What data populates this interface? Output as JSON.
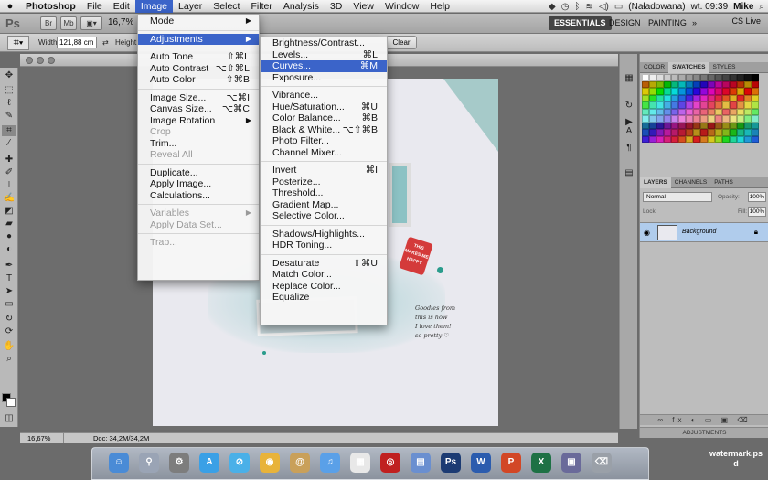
{
  "menubar": {
    "apple": "",
    "app_name": "Photoshop",
    "items": [
      "File",
      "Edit",
      "Image",
      "Layer",
      "Select",
      "Filter",
      "Analysis",
      "3D",
      "View",
      "Window",
      "Help"
    ],
    "battery": "(Naładowana)",
    "clock": "wt. 09:39",
    "user": "Mike"
  },
  "appbar": {
    "ps": "Ps",
    "br": "Br",
    "mb": "Mb",
    "zoom": "16,7%",
    "workspaces": [
      "ESSENTIALS",
      "DESIGN",
      "PAINTING",
      "»"
    ],
    "cs_live": "CS Live"
  },
  "options": {
    "width_label": "Width:",
    "width_value": "121,88 cm",
    "height_label": "Height:",
    "clear_label": "Clear"
  },
  "doc": {
    "zoom_status": "16,67%",
    "doc_size": "Doc: 34,2M/34,2M",
    "tag_text": "THIS MAKES ME HAPPY",
    "handwriting": "Goodies from\nthis is how\nI love them!\nso pretty ♡"
  },
  "panels": {
    "top_tabs": [
      "COLOR",
      "SWATCHES",
      "STYLES"
    ],
    "layer_tabs": [
      "LAYERS",
      "CHANNELS",
      "PATHS"
    ],
    "blend_mode": "Normal",
    "opacity_label": "Opacity:",
    "opacity_value": "100%",
    "lock_label": "Lock:",
    "fill_label": "Fill:",
    "fill_value": "100%",
    "layer_name": "Background",
    "bottom_label": "ADJUSTMENTS"
  },
  "image_menu": [
    {
      "label": "Mode",
      "submenu": true
    },
    {
      "sep": true
    },
    {
      "label": "Adjustments",
      "submenu": true,
      "highlight": true
    },
    {
      "sep": true
    },
    {
      "label": "Auto Tone",
      "key": "⇧⌘L"
    },
    {
      "label": "Auto Contrast",
      "key": "⌥⇧⌘L"
    },
    {
      "label": "Auto Color",
      "key": "⇧⌘B"
    },
    {
      "sep": true
    },
    {
      "label": "Image Size...",
      "key": "⌥⌘I"
    },
    {
      "label": "Canvas Size...",
      "key": "⌥⌘C"
    },
    {
      "label": "Image Rotation",
      "submenu": true
    },
    {
      "label": "Crop",
      "disabled": true
    },
    {
      "label": "Trim..."
    },
    {
      "label": "Reveal All",
      "disabled": true
    },
    {
      "sep": true
    },
    {
      "label": "Duplicate..."
    },
    {
      "label": "Apply Image..."
    },
    {
      "label": "Calculations..."
    },
    {
      "sep": true
    },
    {
      "label": "Variables",
      "submenu": true,
      "disabled": true
    },
    {
      "label": "Apply Data Set...",
      "disabled": true
    },
    {
      "sep": true
    },
    {
      "label": "Trap...",
      "disabled": true
    }
  ],
  "adjust_menu": [
    {
      "label": "Brightness/Contrast..."
    },
    {
      "label": "Levels...",
      "key": "⌘L"
    },
    {
      "label": "Curves...",
      "key": "⌘M",
      "highlight": true
    },
    {
      "label": "Exposure..."
    },
    {
      "sep": true
    },
    {
      "label": "Vibrance..."
    },
    {
      "label": "Hue/Saturation...",
      "key": "⌘U"
    },
    {
      "label": "Color Balance...",
      "key": "⌘B"
    },
    {
      "label": "Black & White...",
      "key": "⌥⇧⌘B"
    },
    {
      "label": "Photo Filter..."
    },
    {
      "label": "Channel Mixer..."
    },
    {
      "sep": true
    },
    {
      "label": "Invert",
      "key": "⌘I"
    },
    {
      "label": "Posterize..."
    },
    {
      "label": "Threshold..."
    },
    {
      "label": "Gradient Map..."
    },
    {
      "label": "Selective Color..."
    },
    {
      "sep": true
    },
    {
      "label": "Shadows/Highlights..."
    },
    {
      "label": "HDR Toning..."
    },
    {
      "sep": true
    },
    {
      "label": "Desaturate",
      "key": "⇧⌘U"
    },
    {
      "label": "Match Color..."
    },
    {
      "label": "Replace Color..."
    },
    {
      "label": "Equalize"
    }
  ],
  "tools": [
    "move-tool",
    "marquee-tool",
    "lasso-tool",
    "quick-select-tool",
    "crop-tool",
    "eyedropper-tool",
    "spot-heal-tool",
    "brush-tool",
    "stamp-tool",
    "history-brush-tool",
    "eraser-tool",
    "gradient-tool",
    "blur-tool",
    "dodge-tool",
    "pen-tool",
    "type-tool",
    "path-select-tool",
    "shape-tool",
    "3d-rotate-tool",
    "3d-orbit-tool",
    "hand-tool",
    "zoom-tool"
  ],
  "dock_apps": [
    "finder",
    "launchpad",
    "system-preferences",
    "app-store",
    "safari",
    "chrome",
    "contacts",
    "itunes",
    "calendar",
    "photo-booth",
    "preview",
    "photoshop",
    "word",
    "powerpoint",
    "excel",
    "wallpaper",
    "trash"
  ],
  "watermark": "watermark.ps\nd",
  "colors": {
    "highlight": "#3b64c9",
    "layer_selected": "#b0ccec"
  }
}
